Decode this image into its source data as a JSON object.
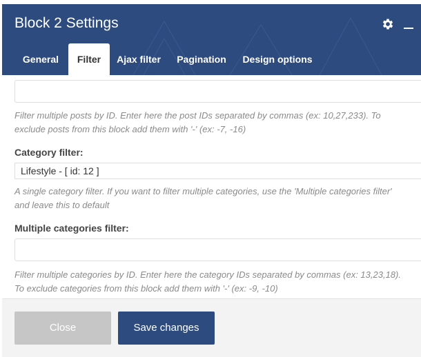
{
  "dialog": {
    "title": "Block 2 Settings",
    "accent_color": "#2d4b7e"
  },
  "header_icons": {
    "settings": "gear-icon",
    "minimize": "minimize-icon"
  },
  "tabs": [
    {
      "label": "General"
    },
    {
      "label": "Filter",
      "active": true
    },
    {
      "label": "Ajax filter"
    },
    {
      "label": "Pagination"
    },
    {
      "label": "Design options"
    }
  ],
  "filter": {
    "post_ids": {
      "value": "",
      "help_line1": "Filter multiple posts by ID. Enter here the post IDs separated by commas (ex: 10,27,233). To",
      "help_line2": "exclude posts from this block add them with '-' (ex: -7, -16)"
    },
    "category": {
      "label": "Category filter:",
      "value": "Lifestyle - [ id: 12 ]",
      "help_line1": "A single category filter. If you want to filter multiple categories, use the 'Multiple categories filter'",
      "help_line2": "and leave this to default"
    },
    "multiple_categories": {
      "label": "Multiple categories filter:",
      "value": "",
      "help_line1": "Filter multiple categories by ID. Enter here the category IDs separated by commas (ex: 13,23,18).",
      "help_line2": "To exclude categories from this block add them with '-' (ex: -9, -10)"
    }
  },
  "footer": {
    "close_label": "Close",
    "save_label": "Save changes"
  }
}
